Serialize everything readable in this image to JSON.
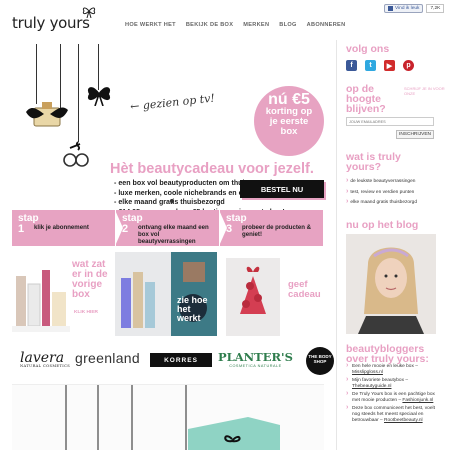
{
  "header": {
    "logo_text": "truly yours",
    "nav": [
      "HOE WERKT HET",
      "BEKIJK DE BOX",
      "MERKEN",
      "BLOG",
      "ABONNEREN"
    ],
    "fb_like_label": "Vind ik leuk",
    "fb_count": "7,2K"
  },
  "hero": {
    "script_text": "gezien op tv!",
    "circle_line1": "nú €5",
    "circle_line2": "korting op",
    "circle_line3": "je eerste",
    "circle_line4": "box",
    "title": "Hèt beautycadeau voor jezelf.",
    "bullets": [
      "- een box vol beautyproducten om thuis te proberen",
      "- luxe merken, coole nichebrands en cultklassiekers",
      "- elke maand gratis thuisbezorgd",
      "- €14,95 per maand, nu €5 korting op je eerste box!"
    ],
    "order_button": "BESTEL NU"
  },
  "steps": [
    {
      "label": "stap",
      "num": "1",
      "text": "klik je abonnement"
    },
    {
      "label": "stap",
      "num": "2",
      "text": "ontvang elke maand een box vol beautyverrassingen"
    },
    {
      "label": "stap",
      "num": "3",
      "text": "probeer de producten & geniet!"
    }
  ],
  "tiles": {
    "tile1_title": "wat zat er in de vorige box",
    "tile1_link": "KLIK HIER",
    "tile2_title": "zie hoe het werkt",
    "tile3_title": "geef cadeau"
  },
  "brands": {
    "lavera": "lavera",
    "lavera_sub": "NATURAL COSMETICS",
    "greenland": "greenland",
    "korres": "KORRES",
    "planters": "PLANTER'S",
    "planters_sub": "COSMETICA NATURALE",
    "bodyshop": "THE BODY SHOP"
  },
  "sidebar": {
    "follow_heading": "volg ons",
    "social_icons": [
      "facebook-icon",
      "twitter-icon",
      "youtube-icon",
      "pinterest-icon"
    ],
    "newsletter_heading": "op de hoogte blijven?",
    "newsletter_note": "SCHRIJF JE IN VOOR ONZE",
    "email_placeholder": "JOUW EMAILADRES",
    "subscribe_button": "INSCHRIJVEN",
    "what_heading": "wat is truly yours?",
    "what_items": [
      "de leukste beautyverrassingen",
      "test, review en verdien punten",
      "elke maand gratis thuisbezorgd"
    ],
    "blog_heading": "nu op het blog",
    "bloggers_heading": "beautybloggers over truly yours:",
    "quotes": [
      {
        "text": "Een hele mooie en leuke box",
        "src": "Misslipgloss.nl"
      },
      {
        "text": "Mijn favoriete beautybox",
        "src": "Thebeautyguide.nl"
      },
      {
        "text": "De Truly Yours box is een pachtige box met mooie producten",
        "src": "Fashionjunk.nl"
      },
      {
        "text": "Deze box communiceert het best, voelt nog steeds het meest speciaal en betrouwbaar",
        "src": "Rootbeetbeauty.nl"
      }
    ]
  },
  "colors": {
    "accent_pink": "#e7a3c2",
    "dark": "#111111"
  }
}
